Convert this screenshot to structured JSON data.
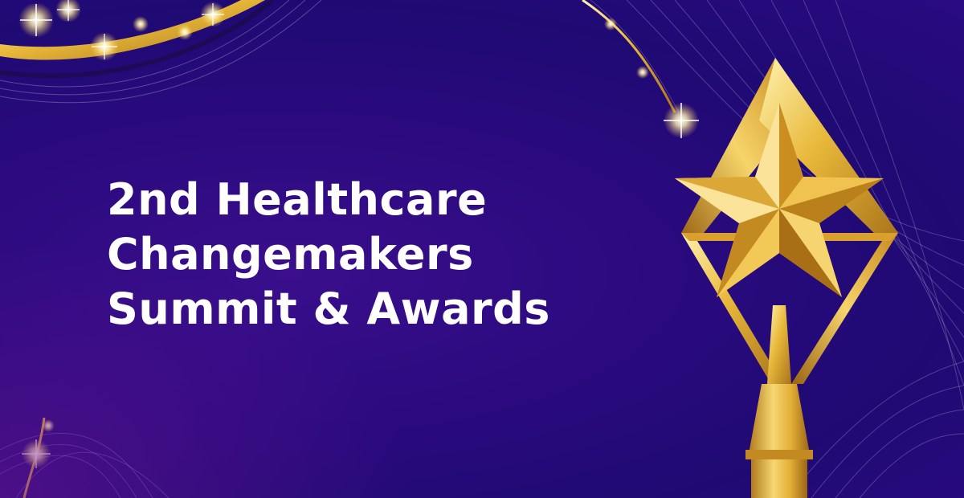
{
  "banner": {
    "title_lines": [
      "2nd Healthcare",
      "Changemakers",
      "Summit & Awards"
    ]
  },
  "colors": {
    "background": "#2a0a7e",
    "gold": "#e8b83a",
    "text": "#ffffff"
  },
  "decorations": {
    "trophy": "gold-star-trophy-icon",
    "sparkles": "sparkle-icon",
    "ribbons": "gold-ribbon-swirl"
  }
}
